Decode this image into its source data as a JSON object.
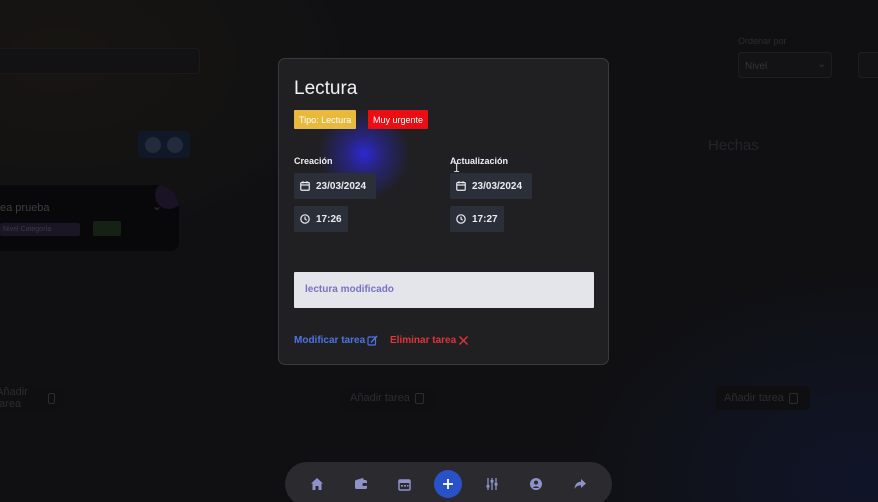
{
  "background": {
    "task_title": "ea prueba",
    "task_badge": "Nivel Categoría",
    "column_title": "Hechas",
    "filter_label": "Ordenar por",
    "filter_value": "Nivel",
    "add_task_label": "Añadir tarea"
  },
  "modal": {
    "title": "Lectura",
    "tags": {
      "type": "Tipo: Lectura",
      "priority": "Muy urgente"
    },
    "created": {
      "label": "Creación",
      "date": "23/03/2024",
      "time": "17:26"
    },
    "updated": {
      "label": "Actualización",
      "date": "23/03/2024",
      "time": "17:27"
    },
    "description": "lectura modificado",
    "actions": {
      "modify": "Modificar tarea",
      "delete": "Eliminar tarea"
    }
  },
  "colors": {
    "tag_type": "#e8b93c",
    "tag_priority": "#ea0d11",
    "modify": "#4c74e2",
    "delete": "#e0343a",
    "nav_add": "#2a52c8"
  },
  "bottom_nav": [
    {
      "icon": "home-icon"
    },
    {
      "icon": "wallet-icon"
    },
    {
      "icon": "calendar-icon"
    },
    {
      "icon": "plus-icon"
    },
    {
      "icon": "sliders-icon"
    },
    {
      "icon": "user-circle-icon"
    },
    {
      "icon": "share-icon"
    }
  ]
}
